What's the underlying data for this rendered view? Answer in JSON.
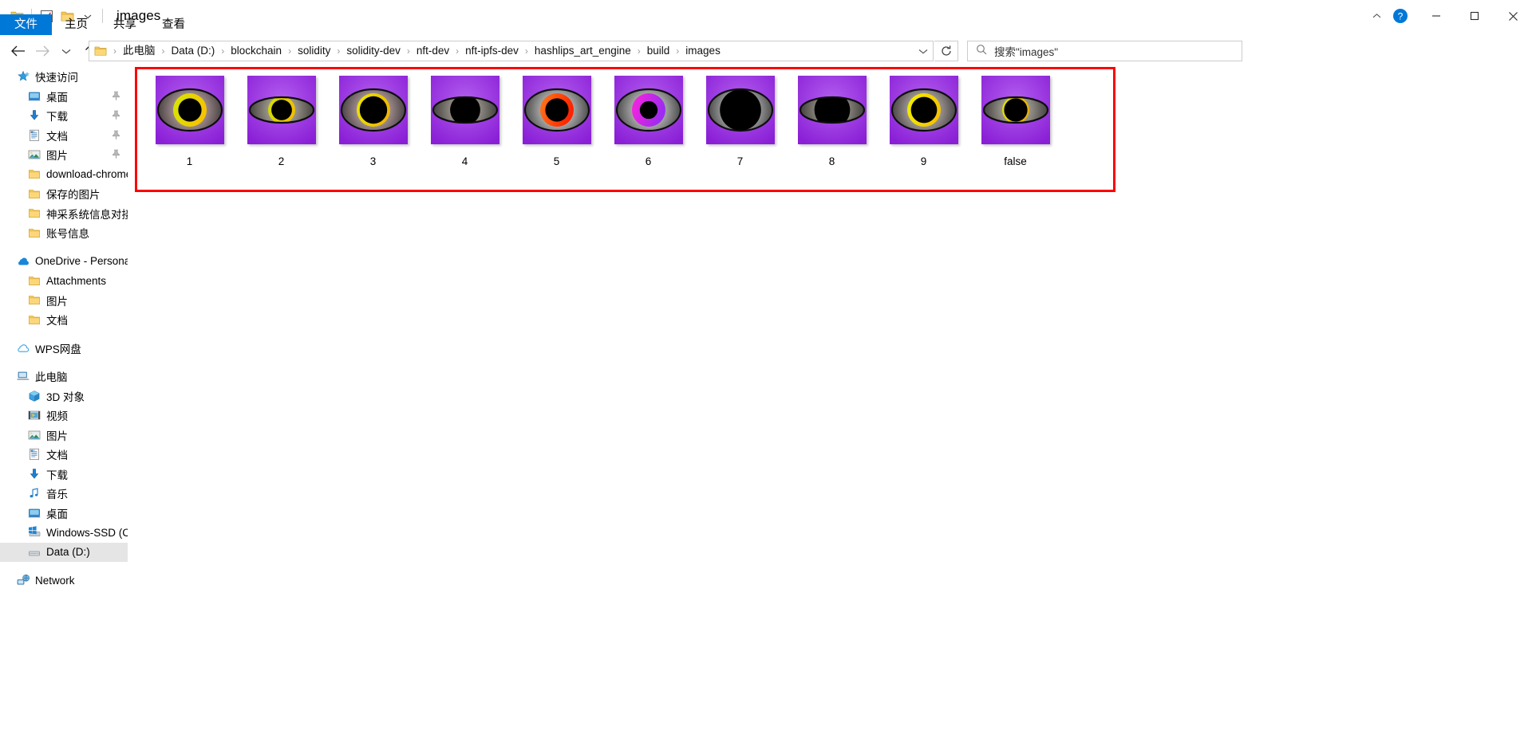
{
  "window": {
    "title": "images",
    "quick_access_icons": [
      "folder-icon",
      "properties-checkbox-icon",
      "new-folder-icon",
      "customize-dropdown-icon"
    ],
    "minimize_label": "—",
    "maximize_label": "❐",
    "close_label": "✕",
    "help_label": "?",
    "collapse_ribbon_label": "⌃"
  },
  "ribbon": {
    "tabs": [
      {
        "label": "文件",
        "active": true
      },
      {
        "label": "主页",
        "active": false
      },
      {
        "label": "共享",
        "active": false
      },
      {
        "label": "查看",
        "active": false
      }
    ]
  },
  "nav": {
    "back_icon": "arrow-left-icon",
    "forward_icon": "arrow-right-icon",
    "recent_icon": "chevron-down-icon",
    "up_icon": "arrow-up-icon",
    "breadcrumb": [
      "此电脑",
      "Data (D:)",
      "blockchain",
      "solidity",
      "solidity-dev",
      "nft-dev",
      "nft-ipfs-dev",
      "hashlips_art_engine",
      "build",
      "images"
    ],
    "separator": "›",
    "dropdown_icon": "chevron-down-icon",
    "refresh_icon": "refresh-icon"
  },
  "search": {
    "icon": "search-icon",
    "value": "搜索\"images\"",
    "placeholder": "搜索\"images\""
  },
  "sidebar": {
    "groups": [
      {
        "header": {
          "label": "快速访问",
          "icon": "star-quick-access-icon",
          "depth": 0
        },
        "items": [
          {
            "label": "桌面",
            "icon": "desktop-icon",
            "depth": 1,
            "pinned": true
          },
          {
            "label": "下载",
            "icon": "download-icon",
            "depth": 1,
            "pinned": true
          },
          {
            "label": "文档",
            "icon": "documents-icon",
            "depth": 1,
            "pinned": true
          },
          {
            "label": "图片",
            "icon": "pictures-icon",
            "depth": 1,
            "pinned": true
          },
          {
            "label": "download-chrome",
            "icon": "folder-icon",
            "depth": 1,
            "pinned": false
          },
          {
            "label": "保存的图片",
            "icon": "folder-icon",
            "depth": 1,
            "pinned": false
          },
          {
            "label": "神采系统信息对接",
            "icon": "folder-icon",
            "depth": 1,
            "pinned": false
          },
          {
            "label": "账号信息",
            "icon": "folder-icon",
            "depth": 1,
            "pinned": false
          }
        ]
      },
      {
        "header": {
          "label": "OneDrive - Personal",
          "icon": "onedrive-icon",
          "depth": 0
        },
        "items": [
          {
            "label": "Attachments",
            "icon": "folder-icon",
            "depth": 1,
            "pinned": false
          },
          {
            "label": "图片",
            "icon": "folder-icon",
            "depth": 1,
            "pinned": false
          },
          {
            "label": "文档",
            "icon": "folder-icon",
            "depth": 1,
            "pinned": false
          }
        ]
      },
      {
        "header": {
          "label": "WPS网盘",
          "icon": "cloud-icon",
          "depth": 0
        },
        "items": []
      },
      {
        "header": {
          "label": "此电脑",
          "icon": "this-pc-icon",
          "depth": 0
        },
        "items": [
          {
            "label": "3D 对象",
            "icon": "3d-objects-icon",
            "depth": 1,
            "pinned": false
          },
          {
            "label": "视频",
            "icon": "videos-icon",
            "depth": 1,
            "pinned": false
          },
          {
            "label": "图片",
            "icon": "pictures-icon",
            "depth": 1,
            "pinned": false
          },
          {
            "label": "文档",
            "icon": "documents-icon",
            "depth": 1,
            "pinned": false
          },
          {
            "label": "下载",
            "icon": "download-icon",
            "depth": 1,
            "pinned": false
          },
          {
            "label": "音乐",
            "icon": "music-icon",
            "depth": 1,
            "pinned": false
          },
          {
            "label": "桌面",
            "icon": "desktop-icon",
            "depth": 1,
            "pinned": false
          },
          {
            "label": "Windows-SSD (C:)",
            "icon": "windows-drive-icon",
            "depth": 1,
            "pinned": false
          },
          {
            "label": "Data (D:)",
            "icon": "drive-icon",
            "depth": 1,
            "pinned": false,
            "selected": true
          }
        ]
      },
      {
        "header": {
          "label": "Network",
          "icon": "network-icon",
          "depth": 0
        },
        "items": []
      }
    ]
  },
  "content": {
    "annotation": {
      "type": "red-rectangle",
      "color": "#fe0000"
    },
    "files": [
      {
        "label": "1",
        "iris": "#d4e800",
        "iris2": "#f5c400",
        "sclera": "#f0cfd2",
        "pupil_r": 0.17,
        "shape": "round",
        "lid": "wide"
      },
      {
        "label": "2",
        "iris": "#cfe000",
        "iris2": "#f0c000",
        "sclera": "#d8d0c0",
        "pupil_r": 0.15,
        "shape": "round",
        "lid": "narrow"
      },
      {
        "label": "3",
        "iris": "#e8ea00",
        "iris2": "#f0b800",
        "sclera": "#f2d2d6",
        "pupil_r": 0.2,
        "shape": "round",
        "lid": "wide"
      },
      {
        "label": "4",
        "iris": "#cde000",
        "iris2": "#e8b800",
        "sclera": "#cfc8bb",
        "pupil_r": 0.22,
        "shape": "round",
        "lid": "narrow"
      },
      {
        "label": "5",
        "iris": "#ff7a1a",
        "iris2": "#ff2200",
        "sclera": "#ffffff",
        "pupil_r": 0.17,
        "shape": "round",
        "lid": "wide"
      },
      {
        "label": "6",
        "iris": "#ff22dd",
        "iris2": "#9b2cf0",
        "sclera": "#ffffff",
        "pupil_r": 0.13,
        "shape": "round",
        "lid": "wide"
      },
      {
        "label": "7",
        "iris": "#ff22dd",
        "iris2": "#9b2cf0",
        "sclera": "#ffffff",
        "pupil_r": 0.3,
        "shape": "round",
        "lid": "wide"
      },
      {
        "label": "8",
        "iris": "#cfe000",
        "iris2": "#f0b800",
        "sclera": "#cfc8bb",
        "pupil_r": 0.26,
        "shape": "round",
        "lid": "narrow"
      },
      {
        "label": "9",
        "iris": "#f2f200",
        "iris2": "#f5c400",
        "sclera": "#ede0dd",
        "pupil_r": 0.19,
        "shape": "round",
        "lid": "wide"
      },
      {
        "label": "false",
        "iris": "#e0e800",
        "iris2": "#e8b000",
        "sclera": "#d6cfc4",
        "pupil_r": 0.17,
        "shape": "round",
        "lid": "narrow"
      }
    ],
    "background_color": "#9a32e0"
  }
}
